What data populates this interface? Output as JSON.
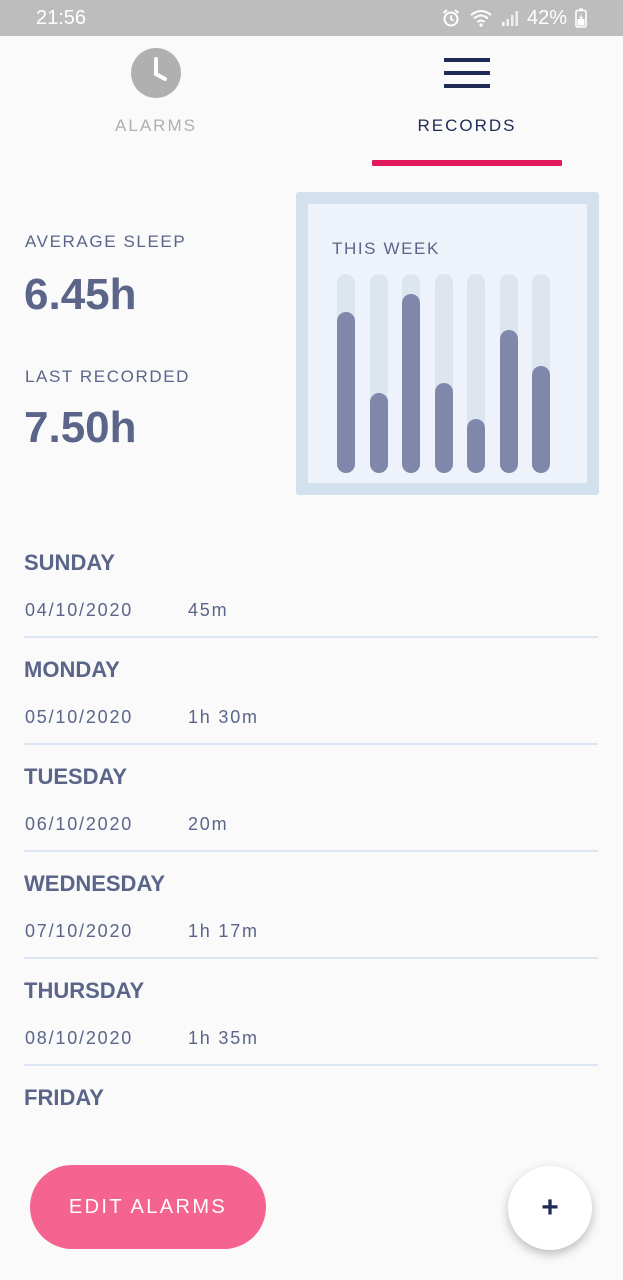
{
  "status_bar": {
    "time": "21:56",
    "battery": "42%",
    "icons": [
      "alarm-clock-icon",
      "wifi-icon",
      "signal-icon",
      "battery-charging-icon"
    ]
  },
  "tabs": [
    {
      "label": "ALARMS",
      "icon": "clock-icon",
      "selected": false
    },
    {
      "label": "RECORDS",
      "icon": "menu-icon",
      "selected": true
    }
  ],
  "colors": {
    "accent": "#e0195f",
    "primary_text": "#5a6589",
    "nav_dark": "#1f2b56",
    "button_pink": "#f56491",
    "bar_fill": "#7f88ab",
    "bar_track": "#dde5ef"
  },
  "stats": {
    "average_label": "AVERAGE SLEEP",
    "average_value": "6.45h",
    "last_label": "LAST RECORDED",
    "last_value": "7.50h"
  },
  "week_chart": {
    "title": "THIS WEEK",
    "chart_data": {
      "type": "bar",
      "values": [
        0.81,
        0.4,
        0.9,
        0.45,
        0.27,
        0.72,
        0.54
      ],
      "ylim": [
        0,
        1
      ]
    }
  },
  "records": [
    {
      "day": "SUNDAY",
      "date": "04/10/2020",
      "duration": "45m"
    },
    {
      "day": "MONDAY",
      "date": "05/10/2020",
      "duration": "1h 30m"
    },
    {
      "day": "TUESDAY",
      "date": "06/10/2020",
      "duration": "20m"
    },
    {
      "day": "WEDNESDAY",
      "date": "07/10/2020",
      "duration": "1h 17m"
    },
    {
      "day": "THURSDAY",
      "date": "08/10/2020",
      "duration": "1h 35m"
    },
    {
      "day": "FRIDAY",
      "date": "",
      "duration": ""
    }
  ],
  "actions": {
    "edit_alarms_label": "EDIT ALARMS",
    "add_label": "+"
  }
}
